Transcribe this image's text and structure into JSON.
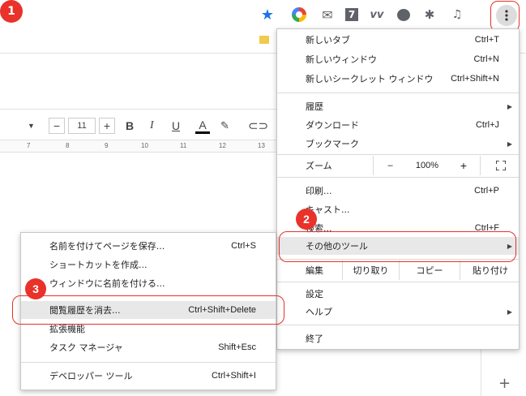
{
  "toolbar": {
    "profile_badge": "1",
    "seven_label": "7",
    "vv_label": "vv"
  },
  "doc": {
    "font_size": "11",
    "ruler_ticks": [
      "7",
      "8",
      "9",
      "10",
      "11",
      "12",
      "13"
    ]
  },
  "main_menu": {
    "items": [
      {
        "label": "新しいタブ",
        "shortcut": "Ctrl+T"
      },
      {
        "label": "新しいウィンドウ",
        "shortcut": "Ctrl+N"
      },
      {
        "label": "新しいシークレット ウィンドウ",
        "shortcut": "Ctrl+Shift+N"
      },
      {
        "label": "履歴",
        "shortcut": ""
      },
      {
        "label": "ダウンロード",
        "shortcut": "Ctrl+J"
      },
      {
        "label": "ブックマーク",
        "shortcut": ""
      },
      {
        "label": "印刷...",
        "shortcut": "Ctrl+P"
      },
      {
        "label": "キャスト...",
        "shortcut": ""
      },
      {
        "label": "検索...",
        "shortcut": "Ctrl+F"
      },
      {
        "label": "その他のツール",
        "shortcut": ""
      },
      {
        "label": "設定",
        "shortcut": ""
      },
      {
        "label": "ヘルプ",
        "shortcut": ""
      },
      {
        "label": "終了",
        "shortcut": ""
      }
    ],
    "zoom": {
      "label": "ズーム",
      "minus": "–",
      "value": "100%",
      "plus": "+"
    },
    "edit": {
      "label": "編集",
      "cut": "切り取り",
      "copy": "コピー",
      "paste": "貼り付け"
    }
  },
  "sub_menu": {
    "items": [
      {
        "label": "名前を付けてページを保存...",
        "shortcut": "Ctrl+S"
      },
      {
        "label": "ショートカットを作成...",
        "shortcut": ""
      },
      {
        "label": "ウィンドウに名前を付ける...",
        "shortcut": ""
      },
      {
        "label": "閲覧履歴を消去...",
        "shortcut": "Ctrl+Shift+Delete"
      },
      {
        "label": "拡張機能",
        "shortcut": ""
      },
      {
        "label": "タスク マネージャ",
        "shortcut": "Shift+Esc"
      },
      {
        "label": "デベロッパー ツール",
        "shortcut": "Ctrl+Shift+I"
      }
    ]
  },
  "callouts": {
    "step1": "1",
    "step2": "2",
    "step3": "3"
  },
  "colors": {
    "callout": "#e8322a",
    "star": "#1a73e8",
    "highlight": "#e8e8e8"
  }
}
